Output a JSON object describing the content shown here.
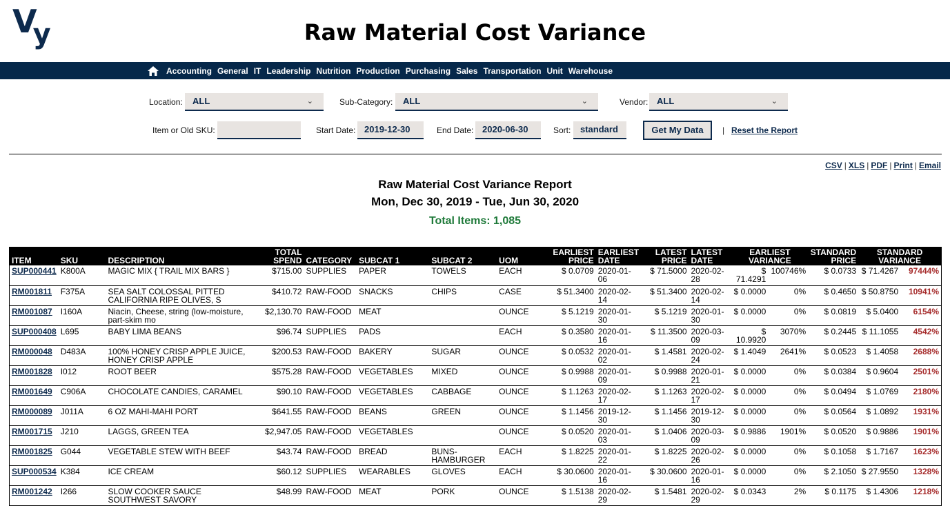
{
  "header": {
    "logo_text_v": "V",
    "logo_text_y": "y",
    "title": "Raw Material Cost Variance"
  },
  "nav": {
    "home_icon": "home-icon",
    "items": [
      "Accounting",
      "General",
      "IT",
      "Leadership",
      "Nutrition",
      "Production",
      "Purchasing",
      "Sales",
      "Transportation",
      "Unit",
      "Warehouse"
    ]
  },
  "filters": {
    "location_label": "Location:",
    "location_value": "ALL",
    "subcategory_label": "Sub-Category:",
    "subcategory_value": "ALL",
    "vendor_label": "Vendor:",
    "vendor_value": "ALL",
    "item_label": "Item or Old SKU:",
    "item_value": "",
    "start_date_label": "Start Date:",
    "start_date_value": "2019-12-30",
    "end_date_label": "End Date:",
    "end_date_value": "2020-06-30",
    "sort_label": "Sort:",
    "sort_value": "standard",
    "get_data_label": "Get My Data",
    "separator": "|",
    "reset_label": "Reset the Report",
    "chevron_glyph": "⌄"
  },
  "exports": {
    "items": [
      "CSV",
      "XLS",
      "PDF",
      "Print",
      "Email"
    ],
    "separator": "|"
  },
  "report": {
    "title": "Raw Material Cost Variance Report",
    "date_range": "Mon, Dec 30, 2019 - Tue, Jun 30, 2020",
    "total_items": "Total Items: 1,085",
    "accent_color": "#a52a2a",
    "total_color": "#1f7a3a"
  },
  "table": {
    "headers": {
      "item": "ITEM",
      "sku": "SKU",
      "description": "DESCRIPTION",
      "total_spend_1": "TOTAL",
      "total_spend_2": "SPEND",
      "category": "CATEGORY",
      "subcat1": "SUBCAT 1",
      "subcat2": "SUBCAT 2",
      "uom": "UOM",
      "earliest_price_1": "EARLIEST",
      "earliest_price_2": "PRICE",
      "earliest_date_1": "EARLIEST",
      "earliest_date_2": "DATE",
      "latest_price_1": "LATEST",
      "latest_price_2": "PRICE",
      "latest_date_1": "LATEST",
      "latest_date_2": "DATE",
      "earliest_variance_1": "EARLIEST",
      "earliest_variance_2": "VARIANCE",
      "standard_price_1": "STANDARD",
      "standard_price_2": "PRICE",
      "standard_variance_1": "STANDARD",
      "standard_variance_2": "VARIANCE"
    },
    "rows": [
      {
        "item": "SUP000441",
        "sku": "K800A",
        "description": "MAGIC MIX { TRAIL MIX BARS }",
        "total_spend": "$715.00",
        "category": "SUPPLIES",
        "subcat1": "PAPER",
        "subcat2": "TOWELS",
        "uom": "EACH",
        "earliest_price": "$ 0.0709",
        "earliest_date": "2020-01-06",
        "latest_price": "$ 71.5000",
        "latest_date": "2020-02-28",
        "earliest_variance_amt": "$ 71.4291",
        "earliest_variance_pct": "100746%",
        "standard_price": "$ 0.0733",
        "standard_variance_amt": "$ 71.4267",
        "standard_variance_pct": "97444%"
      },
      {
        "item": "RM001811",
        "sku": "F375A",
        "description": "SEA SALT COLOSSAL PITTED CALIFORNIA RIPE OLIVES, S",
        "total_spend": "$410.72",
        "category": "RAW-FOOD",
        "subcat1": "SNACKS",
        "subcat2": "CHIPS",
        "uom": "CASE",
        "earliest_price": "$ 51.3400",
        "earliest_date": "2020-02-14",
        "latest_price": "$ 51.3400",
        "latest_date": "2020-02-14",
        "earliest_variance_amt": "$ 0.0000",
        "earliest_variance_pct": "0%",
        "standard_price": "$ 0.4650",
        "standard_variance_amt": "$ 50.8750",
        "standard_variance_pct": "10941%"
      },
      {
        "item": "RM001087",
        "sku": "I160A",
        "description": "Niacin, Cheese, string (low-moisture, part-skim mo",
        "total_spend": "$2,130.70",
        "category": "RAW-FOOD",
        "subcat1": "MEAT",
        "subcat2": "",
        "uom": "OUNCE",
        "earliest_price": "$ 5.1219",
        "earliest_date": "2020-01-30",
        "latest_price": "$ 5.1219",
        "latest_date": "2020-01-30",
        "earliest_variance_amt": "$ 0.0000",
        "earliest_variance_pct": "0%",
        "standard_price": "$ 0.0819",
        "standard_variance_amt": "$ 5.0400",
        "standard_variance_pct": "6154%"
      },
      {
        "item": "SUP000408",
        "sku": "L695",
        "description": "BABY LIMA BEANS",
        "total_spend": "$96.74",
        "category": "SUPPLIES",
        "subcat1": "PADS",
        "subcat2": "",
        "uom": "EACH",
        "earliest_price": "$ 0.3580",
        "earliest_date": "2020-01-16",
        "latest_price": "$ 11.3500",
        "latest_date": "2020-03-09",
        "earliest_variance_amt": "$ 10.9920",
        "earliest_variance_pct": "3070%",
        "standard_price": "$ 0.2445",
        "standard_variance_amt": "$ 11.1055",
        "standard_variance_pct": "4542%"
      },
      {
        "item": "RM000048",
        "sku": "D483A",
        "description": "100% HONEY CRISP APPLE JUICE, HONEY CRISP APPLE",
        "total_spend": "$200.53",
        "category": "RAW-FOOD",
        "subcat1": "BAKERY",
        "subcat2": "SUGAR",
        "uom": "OUNCE",
        "earliest_price": "$ 0.0532",
        "earliest_date": "2020-01-02",
        "latest_price": "$ 1.4581",
        "latest_date": "2020-02-24",
        "earliest_variance_amt": "$ 1.4049",
        "earliest_variance_pct": "2641%",
        "standard_price": "$ 0.0523",
        "standard_variance_amt": "$ 1.4058",
        "standard_variance_pct": "2688%"
      },
      {
        "item": "RM001828",
        "sku": "I012",
        "description": "ROOT BEER",
        "total_spend": "$575.28",
        "category": "RAW-FOOD",
        "subcat1": "VEGETABLES",
        "subcat2": "MIXED",
        "uom": "OUNCE",
        "earliest_price": "$ 0.9988",
        "earliest_date": "2020-01-09",
        "latest_price": "$ 0.9988",
        "latest_date": "2020-01-21",
        "earliest_variance_amt": "$ 0.0000",
        "earliest_variance_pct": "0%",
        "standard_price": "$ 0.0384",
        "standard_variance_amt": "$ 0.9604",
        "standard_variance_pct": "2501%"
      },
      {
        "item": "RM001649",
        "sku": "C906A",
        "description": "CHOCOLATE CANDIES, CARAMEL",
        "total_spend": "$90.10",
        "category": "RAW-FOOD",
        "subcat1": "VEGETABLES",
        "subcat2": "CABBAGE",
        "uom": "OUNCE",
        "earliest_price": "$ 1.1263",
        "earliest_date": "2020-02-17",
        "latest_price": "$ 1.1263",
        "latest_date": "2020-02-17",
        "earliest_variance_amt": "$ 0.0000",
        "earliest_variance_pct": "0%",
        "standard_price": "$ 0.0494",
        "standard_variance_amt": "$ 1.0769",
        "standard_variance_pct": "2180%"
      },
      {
        "item": "RM000089",
        "sku": "J011A",
        "description": "6 OZ MAHI-MAHI PORT",
        "total_spend": "$641.55",
        "category": "RAW-FOOD",
        "subcat1": "BEANS",
        "subcat2": "GREEN",
        "uom": "OUNCE",
        "earliest_price": "$ 1.1456",
        "earliest_date": "2019-12-30",
        "latest_price": "$ 1.1456",
        "latest_date": "2019-12-30",
        "earliest_variance_amt": "$ 0.0000",
        "earliest_variance_pct": "0%",
        "standard_price": "$ 0.0564",
        "standard_variance_amt": "$ 1.0892",
        "standard_variance_pct": "1931%"
      },
      {
        "item": "RM001715",
        "sku": "J210",
        "description": "LAGGS, GREEN TEA",
        "total_spend": "$2,947.05",
        "category": "RAW-FOOD",
        "subcat1": "VEGETABLES",
        "subcat2": "",
        "uom": "OUNCE",
        "earliest_price": "$ 0.0520",
        "earliest_date": "2020-01-03",
        "latest_price": "$ 1.0406",
        "latest_date": "2020-03-09",
        "earliest_variance_amt": "$ 0.9886",
        "earliest_variance_pct": "1901%",
        "standard_price": "$ 0.0520",
        "standard_variance_amt": "$ 0.9886",
        "standard_variance_pct": "1901%"
      },
      {
        "item": "RM001825",
        "sku": "G044",
        "description": "VEGETABLE STEW WITH BEEF",
        "total_spend": "$43.74",
        "category": "RAW-FOOD",
        "subcat1": "BREAD",
        "subcat2": "BUNS-HAMBURGER",
        "uom": "EACH",
        "earliest_price": "$ 1.8225",
        "earliest_date": "2020-01-22",
        "latest_price": "$ 1.8225",
        "latest_date": "2020-02-26",
        "earliest_variance_amt": "$ 0.0000",
        "earliest_variance_pct": "0%",
        "standard_price": "$ 0.1058",
        "standard_variance_amt": "$ 1.7167",
        "standard_variance_pct": "1623%"
      },
      {
        "item": "SUP000534",
        "sku": "K384",
        "description": "ICE CREAM",
        "total_spend": "$60.12",
        "category": "SUPPLIES",
        "subcat1": "WEARABLES",
        "subcat2": "GLOVES",
        "uom": "EACH",
        "earliest_price": "$ 30.0600",
        "earliest_date": "2020-01-16",
        "latest_price": "$ 30.0600",
        "latest_date": "2020-01-16",
        "earliest_variance_amt": "$ 0.0000",
        "earliest_variance_pct": "0%",
        "standard_price": "$ 2.1050",
        "standard_variance_amt": "$ 27.9550",
        "standard_variance_pct": "1328%"
      },
      {
        "item": "RM001242",
        "sku": "I266",
        "description": "SLOW COOKER SAUCE SOUTHWEST SAVORY",
        "total_spend": "$48.99",
        "category": "RAW-FOOD",
        "subcat1": "MEAT",
        "subcat2": "PORK",
        "uom": "OUNCE",
        "earliest_price": "$ 1.5138",
        "earliest_date": "2020-02-29",
        "latest_price": "$ 1.5481",
        "latest_date": "2020-02-29",
        "earliest_variance_amt": "$ 0.0343",
        "earliest_variance_pct": "2%",
        "standard_price": "$ 0.1175",
        "standard_variance_amt": "$ 1.4306",
        "standard_variance_pct": "1218%"
      }
    ]
  }
}
